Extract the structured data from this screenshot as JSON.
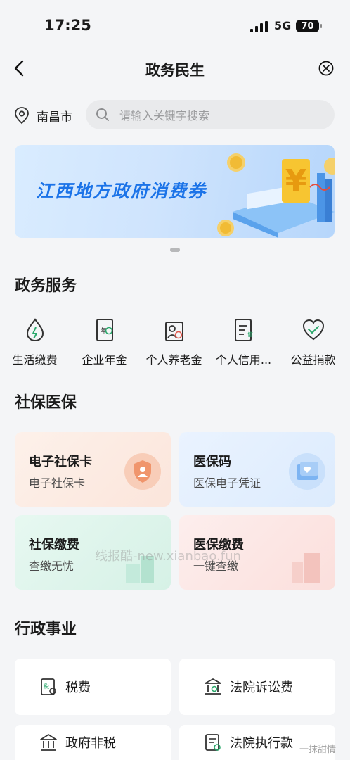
{
  "status_bar": {
    "time": "17:25",
    "network": "5G",
    "battery": "70"
  },
  "nav": {
    "title": "政务民生"
  },
  "location": {
    "city": "南昌市"
  },
  "search": {
    "placeholder": "请输入关键字搜索"
  },
  "banner": {
    "text": "江西地方政府消费券"
  },
  "sections": {
    "gov_services": "政务服务",
    "social_medical": "社保医保",
    "admin_affairs": "行政事业"
  },
  "services": [
    {
      "label": "生活缴费",
      "icon": "water-drop-icon"
    },
    {
      "label": "企业年金",
      "icon": "annuity-doc-icon"
    },
    {
      "label": "个人养老金",
      "icon": "pension-icon"
    },
    {
      "label": "个人信用...",
      "icon": "credit-doc-icon"
    },
    {
      "label": "公益捐款",
      "icon": "charity-heart-icon"
    }
  ],
  "social_cards": [
    {
      "title": "电子社保卡",
      "subtitle": "电子社保卡",
      "icon": "shield-person-icon"
    },
    {
      "title": "医保码",
      "subtitle": "医保电子凭证",
      "icon": "medical-card-icon"
    },
    {
      "title": "社保缴费",
      "subtitle": "查缴无忧",
      "icon": "building-icon"
    },
    {
      "title": "医保缴费",
      "subtitle": "一键查缴",
      "icon": "building-icon"
    }
  ],
  "admin_items": [
    {
      "label": "税费",
      "icon": "tax-icon"
    },
    {
      "label": "法院诉讼费",
      "icon": "court-icon"
    },
    {
      "label": "政府非税",
      "icon": "government-icon"
    },
    {
      "label": "法院执行款",
      "icon": "court-doc-icon"
    }
  ],
  "watermark": "线报酷-new.xianbao.fun",
  "corner_watermark": "一抹甜情",
  "colors": {
    "accent": "#1b73e8",
    "background": "#f4f5f7",
    "icon_green": "#2aa86b"
  }
}
